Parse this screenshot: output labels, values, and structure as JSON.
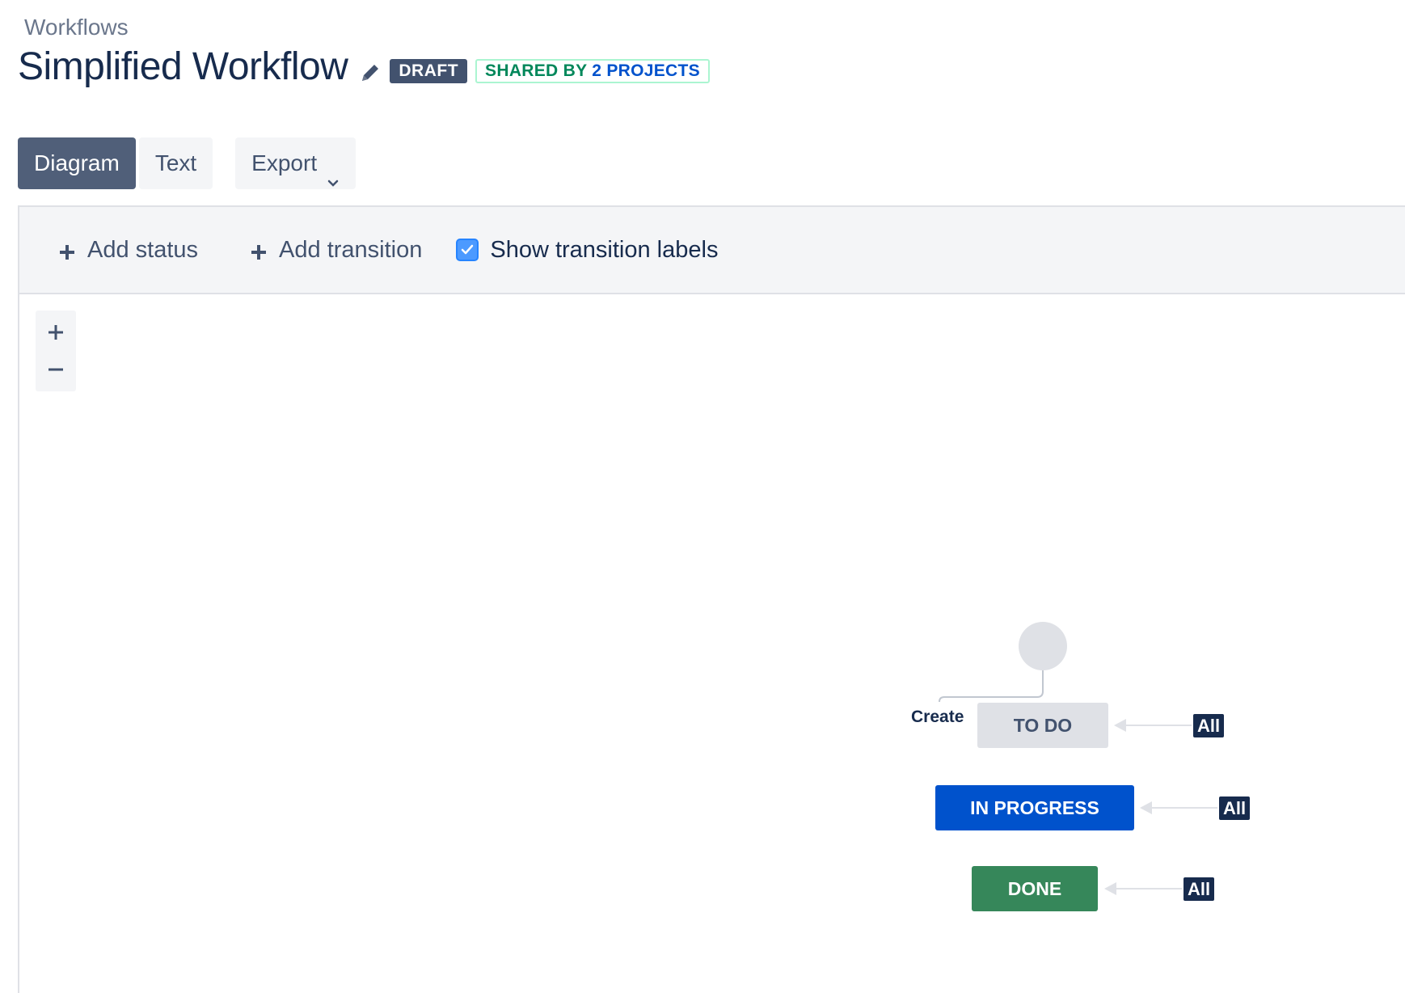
{
  "header": {
    "breadcrumb": "Workflows",
    "title": "Simplified Workflow",
    "draft_badge": "DRAFT",
    "shared_prefix": "SHARED BY",
    "shared_link": "2 PROJECTS"
  },
  "view_tabs": {
    "diagram": "Diagram",
    "text": "Text",
    "export": "Export"
  },
  "toolbar": {
    "add_status": "Add status",
    "add_transition": "Add transition",
    "show_labels": "Show transition labels",
    "show_labels_checked": true
  },
  "zoom": {
    "in": "+",
    "out": "−"
  },
  "diagram": {
    "create_label": "Create",
    "statuses": [
      {
        "name": "TO DO",
        "color": "#dfe1e6"
      },
      {
        "name": "IN PROGRESS",
        "color": "#0052cc"
      },
      {
        "name": "DONE",
        "color": "#36875a"
      }
    ],
    "global_transition_label": "All"
  },
  "colors": {
    "primary": "#0052cc",
    "dark": "#172b4d",
    "active_tab": "#505f79",
    "success": "#36875a"
  }
}
